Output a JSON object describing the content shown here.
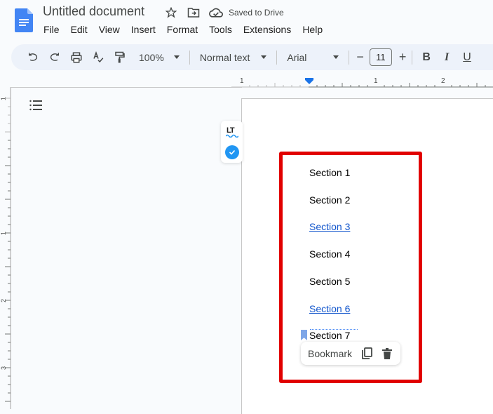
{
  "header": {
    "title": "Untitled document",
    "saved_status": "Saved to Drive",
    "icons": [
      "star-icon",
      "move-folder-icon",
      "cloud-saved-icon"
    ]
  },
  "menu": [
    "File",
    "Edit",
    "View",
    "Insert",
    "Format",
    "Tools",
    "Extensions",
    "Help"
  ],
  "toolbar": {
    "zoom": "100%",
    "style": "Normal text",
    "font": "Arial",
    "font_size": "11",
    "bold": "B",
    "italic": "I",
    "underline": "U",
    "minus": "−",
    "plus": "+"
  },
  "ruler": {
    "horizontal_labels": [
      "1",
      "1",
      "2"
    ],
    "vertical_labels": [
      "1",
      "1",
      "2",
      "3"
    ]
  },
  "document": {
    "sections": [
      {
        "text": "Section 1",
        "link": false
      },
      {
        "text": "Section 2",
        "link": false
      },
      {
        "text": "Section 3",
        "link": true
      },
      {
        "text": "Section 4",
        "link": false
      },
      {
        "text": "Section 5",
        "link": false
      },
      {
        "text": "Section 6",
        "link": true
      },
      {
        "text": "Section 7",
        "link": false
      }
    ]
  },
  "bookmark_popup": {
    "label": "Bookmark"
  },
  "languagetool": {
    "logo": "LT"
  },
  "colors": {
    "accent": "#1a73e8",
    "highlight_box": "#e10000",
    "link": "#1155cc",
    "toolbar_bg": "#edf2fa"
  }
}
